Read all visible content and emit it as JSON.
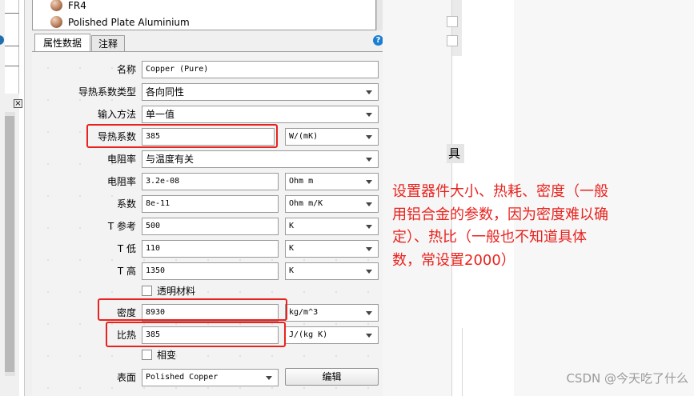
{
  "materials_list": {
    "items": [
      "FR4",
      "Polished Plate Aluminium"
    ]
  },
  "tabs": [
    {
      "label": "属性数据"
    },
    {
      "label": "注释"
    }
  ],
  "help_icon": "?",
  "close_icon": "×",
  "form": {
    "name": {
      "label": "名称",
      "value": "Copper (Pure)"
    },
    "conductivity_type": {
      "label": "导热系数类型",
      "value": "各向同性"
    },
    "input_method": {
      "label": "输入方法",
      "value": "单一值"
    },
    "conductivity": {
      "label": "导热系数",
      "value": "385",
      "unit": "W/(mK)"
    },
    "resistivity_mode": {
      "label": "电阻率",
      "value": "与温度有关"
    },
    "resistivity": {
      "label": "电阻率",
      "value": "3.2e-08",
      "unit": "Ohm m"
    },
    "coefficient": {
      "label": "系数",
      "value": "8e-11",
      "unit": "Ohm m/K"
    },
    "t_ref": {
      "label": "T 参考",
      "value": "500",
      "unit": "K"
    },
    "t_low": {
      "label": "T 低",
      "value": "110",
      "unit": "K"
    },
    "t_high": {
      "label": "T 高",
      "value": "1350",
      "unit": "K"
    },
    "transparent": {
      "label": "透明材料",
      "checked": false
    },
    "density": {
      "label": "密度",
      "value": "8930",
      "unit": "kg/m^3"
    },
    "specific_heat": {
      "label": "比热",
      "value": "385",
      "unit": "J/(kg K)"
    },
    "phase_change": {
      "label": "相变",
      "checked": false
    },
    "surface": {
      "label": "表面",
      "value": "Polished Copper",
      "edit_button": "编辑"
    }
  },
  "side_fragment": "具",
  "annotation": {
    "lines": [
      "设置器件大小、热耗、密度（一般",
      "用铝合金的参数，因为密度难以确",
      "定）、热比（一般也不知道具体",
      "数，常设置2000）"
    ],
    "color": "#e8231e"
  },
  "watermark": "CSDN @今天吃了什么",
  "colors": {
    "highlight": "#e8231e",
    "help_blue": "#1b7fd1"
  }
}
